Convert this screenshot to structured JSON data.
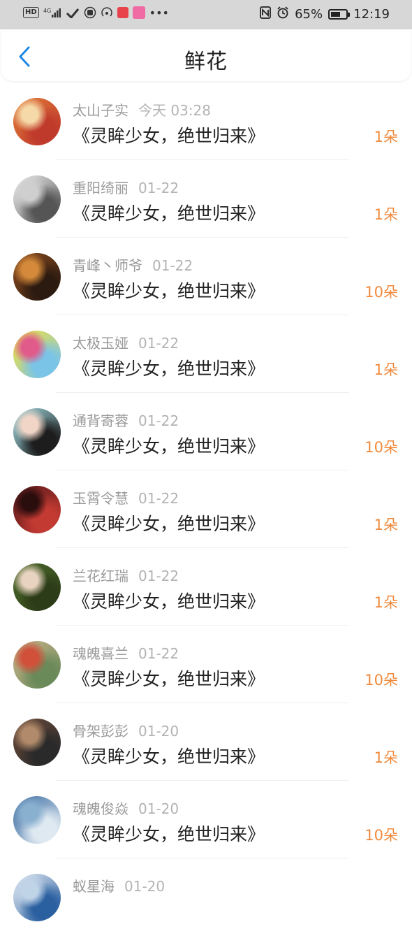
{
  "status_bar": {
    "left_indicators": [
      "HD",
      "4G"
    ],
    "battery_percent": "65%",
    "battery_level": 0.65,
    "time": "12:19"
  },
  "header": {
    "title": "鲜花"
  },
  "items": [
    {
      "name": "太山子实",
      "date": "今天 03:28",
      "book": "《灵眸少女，绝世归来》",
      "count": "1朵",
      "avatar_colors": [
        "#e07b39",
        "#c03a2b",
        "#f6d9a8"
      ]
    },
    {
      "name": "重阳绮丽",
      "date": "01-22",
      "book": "《灵眸少女，绝世归来》",
      "count": "1朵",
      "avatar_colors": [
        "#f2f2f2",
        "#555555",
        "#cfcfcf"
      ]
    },
    {
      "name": "青峰丶师爷",
      "date": "01-22",
      "book": "《灵眸少女，绝世归来》",
      "count": "10朵",
      "avatar_colors": [
        "#8a4b1f",
        "#2b1a10",
        "#d48a3a"
      ]
    },
    {
      "name": "太极玉娅",
      "date": "01-22",
      "book": "《灵眸少女，绝世归来》",
      "count": "1朵",
      "avatar_colors": [
        "#f5e23a",
        "#7ac4e8",
        "#e05a8a"
      ]
    },
    {
      "name": "通背寄蓉",
      "date": "01-22",
      "book": "《灵眸少女，绝世归来》",
      "count": "10朵",
      "avatar_colors": [
        "#9fd8e0",
        "#1d1d1d",
        "#f1d6c8"
      ]
    },
    {
      "name": "玉霄令慧",
      "date": "01-22",
      "book": "《灵眸少女，绝世归来》",
      "count": "1朵",
      "avatar_colors": [
        "#5a1a1a",
        "#c23a32",
        "#2a0d0d"
      ]
    },
    {
      "name": "兰花红瑞",
      "date": "01-22",
      "book": "《灵眸少女，绝世归来》",
      "count": "1朵",
      "avatar_colors": [
        "#4c6b2a",
        "#2c3b18",
        "#e8d3c0"
      ]
    },
    {
      "name": "魂魄喜兰",
      "date": "01-22",
      "book": "《灵眸少女，绝世归来》",
      "count": "10朵",
      "avatar_colors": [
        "#c9b48a",
        "#6b8a5a",
        "#d0503a"
      ]
    },
    {
      "name": "骨架彭彭",
      "date": "01-20",
      "book": "《灵眸少女，绝世归来》",
      "count": "1朵",
      "avatar_colors": [
        "#6a4a3a",
        "#2a2a2a",
        "#b08a6a"
      ]
    },
    {
      "name": "魂魄俊焱",
      "date": "01-20",
      "book": "《灵眸少女，绝世归来》",
      "count": "10朵",
      "avatar_colors": [
        "#3a6aa0",
        "#dfe9f2",
        "#8ab0d0"
      ]
    },
    {
      "name": "蚁星海",
      "date": "01-20",
      "book": "",
      "count": "",
      "avatar_colors": [
        "#e8eef4",
        "#2a5fa0",
        "#c0d4e8"
      ]
    }
  ]
}
